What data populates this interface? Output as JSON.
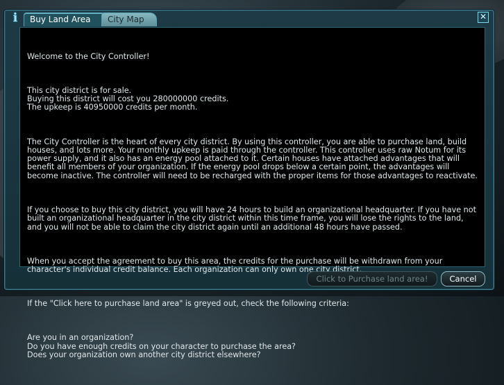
{
  "window": {
    "tabs": [
      {
        "label": "Buy Land Area",
        "active": true
      },
      {
        "label": "City Map",
        "active": false
      }
    ],
    "close_label": "✕"
  },
  "content": {
    "paragraphs": [
      "Welcome to the City Controller!",
      "This city district is for sale.\nBuying this district will cost you 280000000 credits.\nThe upkeep is 40950000 credits per month.",
      "The City Controller is the heart of every city district. By using this controller, you are able to purchase land, build houses, and lots more. Your monthly upkeep is paid through the controller. This controller uses raw Notum for its power supply, and it also has an energy pool attached to it. Certain houses have attached advantages that will benefit all members of your organization. If the energy pool drops below a certain point, the advantages will become inactive. The controller will need to be recharged with the proper items for those advantages to reactivate.",
      "If you choose to buy this city district, you will have 24 hours to build an organizational headquarter. If you have not built an organizational headquarter in the city district within this time frame, you will lose the rights to the land, and you will not be able to claim the city district again until an additional 48 hours have passed.",
      "When you accept the agreement to buy this area, the credits for the purchase will be withdrawn from your character's individual credit balance. Each organization can only own one city district.",
      "If the \"Click here to purchase land area\" is greyed out, check the following criteria:",
      "Are you in an organization?\nDo you have enough credits on your character to purchase the area?\nDoes your organization own another city district elsewhere?"
    ]
  },
  "buttons": {
    "purchase_label": "Click to Purchase land area!",
    "purchase_enabled": false,
    "cancel_label": "Cancel"
  },
  "colors": {
    "frame": "#1d3a46",
    "border_accent": "#3f7d8e",
    "text": "#dfe7ea"
  },
  "icons": {
    "info": "info-icon",
    "close": "close-icon"
  }
}
